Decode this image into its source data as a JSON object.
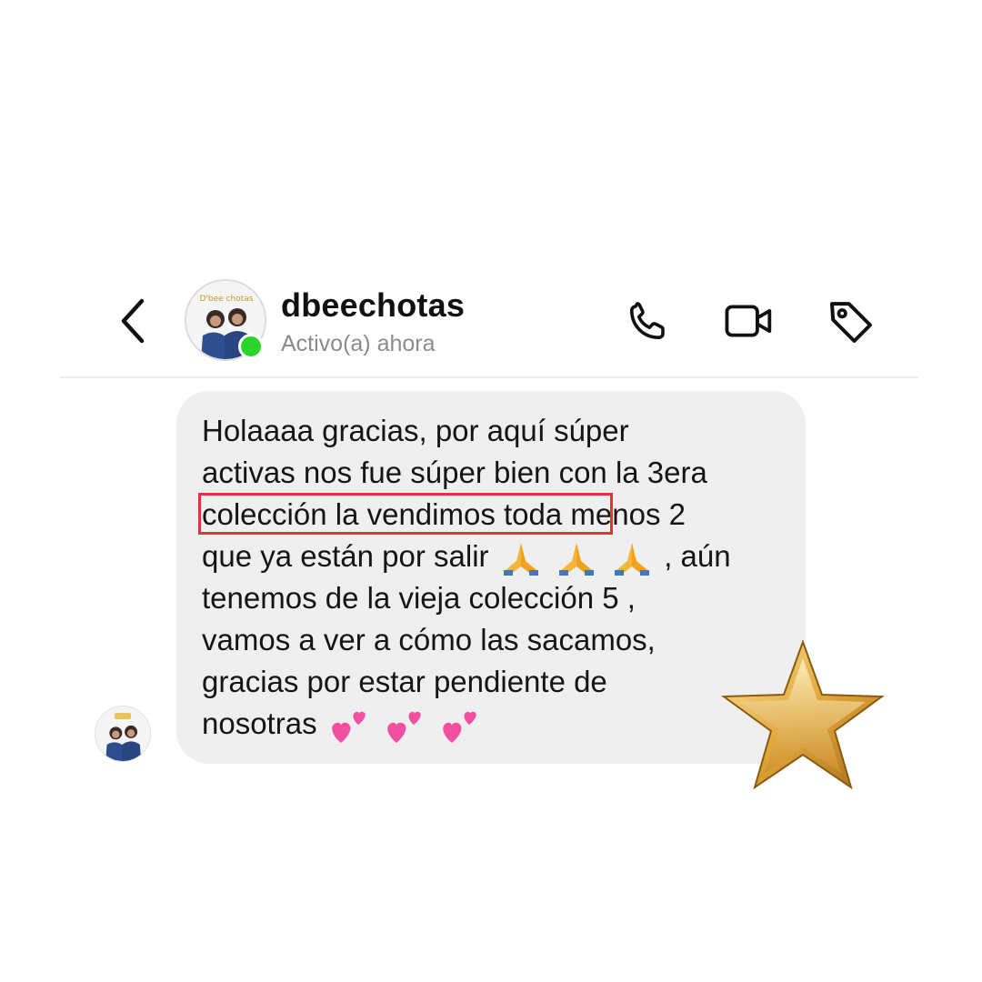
{
  "header": {
    "username": "dbeechotas",
    "status": "Activo(a) ahora",
    "avatar_logo_text": "D'bee chotas"
  },
  "message": {
    "lines": [
      "Holaaaa gracias, por aquí súper",
      "activas nos fue súper bien con la 3era",
      "colección la vendimos toda menos 2",
      "que ya están por salir",
      ", aún",
      "tenemos de la vieja colección 5 ,",
      "vamos a ver a cómo las sacamos,",
      "gracias por estar pendiente de",
      "nosotras"
    ]
  },
  "icons": {
    "back": "chevron-left-icon",
    "call": "phone-icon",
    "video": "video-camera-icon",
    "tag": "tag-icon",
    "pray": "folded-hands-emoji",
    "hearts": "two-hearts-emoji",
    "decoration": "gold-star"
  },
  "colors": {
    "online": "#2bd42b",
    "bubble": "#efefef",
    "highlight": "#e2323b",
    "star": "#d9a43a"
  }
}
